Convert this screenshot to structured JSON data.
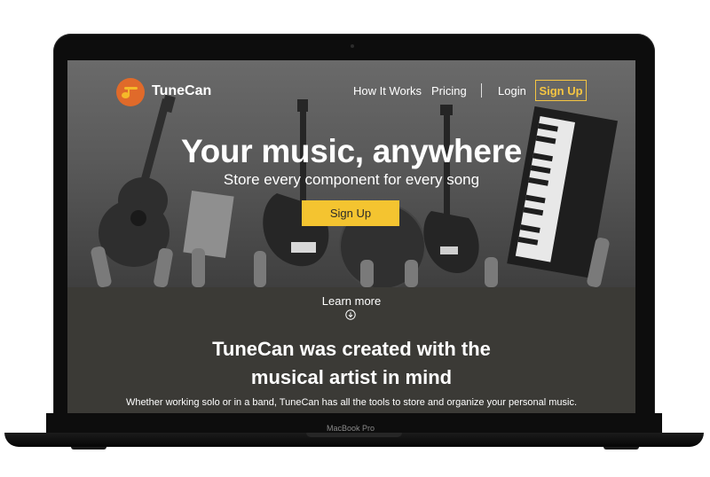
{
  "device": {
    "model_label": "MacBook Pro"
  },
  "nav": {
    "brand": "TuneCan",
    "links": [
      "How It Works",
      "Pricing",
      "Login"
    ],
    "signup_label": "Sign Up"
  },
  "hero": {
    "title": "Your music, anywhere",
    "subtitle": "Store every component for every song",
    "cta_label": "Sign Up"
  },
  "section": {
    "learn_more": "Learn more",
    "heading_line1": "TuneCan was created with the",
    "heading_line2": "musical artist in mind",
    "body": "Whether working solo or in a band, TuneCan has all the tools to store and organize your personal music."
  },
  "colors": {
    "accent": "#f4c430",
    "logo": "#e06a2a",
    "section_bg": "#3b3a36"
  },
  "icons": [
    "music-note-icon",
    "circle-arrow-down-icon"
  ]
}
